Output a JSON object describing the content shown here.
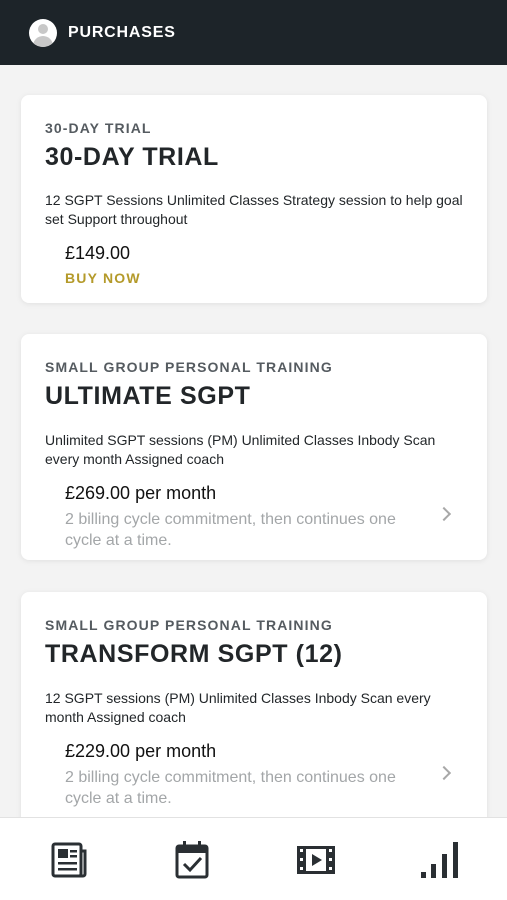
{
  "header": {
    "title": "PURCHASES",
    "avatar_icon": "user-avatar-icon"
  },
  "cards": [
    {
      "eyebrow": "30-DAY TRIAL",
      "title": "30-DAY TRIAL",
      "description": "12 SGPT Sessions Unlimited Classes Strategy session to help goal set Support throughout",
      "price": "£149.00",
      "action": "BUY NOW"
    },
    {
      "eyebrow": "SMALL GROUP PERSONAL TRAINING",
      "title": "ULTIMATE SGPT",
      "description": "Unlimited SGPT sessions (PM) Unlimited Classes Inbody Scan every month Assigned coach",
      "price": "£269.00 per month",
      "note": "2 billing cycle commitment, then continues one cycle at a time."
    },
    {
      "eyebrow": "SMALL GROUP PERSONAL TRAINING",
      "title": "TRANSFORM SGPT (12)",
      "description": "12 SGPT sessions (PM) Unlimited Classes Inbody Scan every month Assigned coach",
      "price": "£229.00 per month",
      "note": "2 billing cycle commitment, then continues one cycle at a time."
    }
  ],
  "tabbar": {
    "items": [
      {
        "icon": "news-icon"
      },
      {
        "icon": "calendar-check-icon"
      },
      {
        "icon": "video-icon"
      },
      {
        "icon": "bar-chart-icon"
      }
    ]
  },
  "colors": {
    "header_bg": "#1d2429",
    "buy_accent": "#b49a2a",
    "note_text": "#a3a6a8",
    "icon_dark": "#2a2f33"
  }
}
